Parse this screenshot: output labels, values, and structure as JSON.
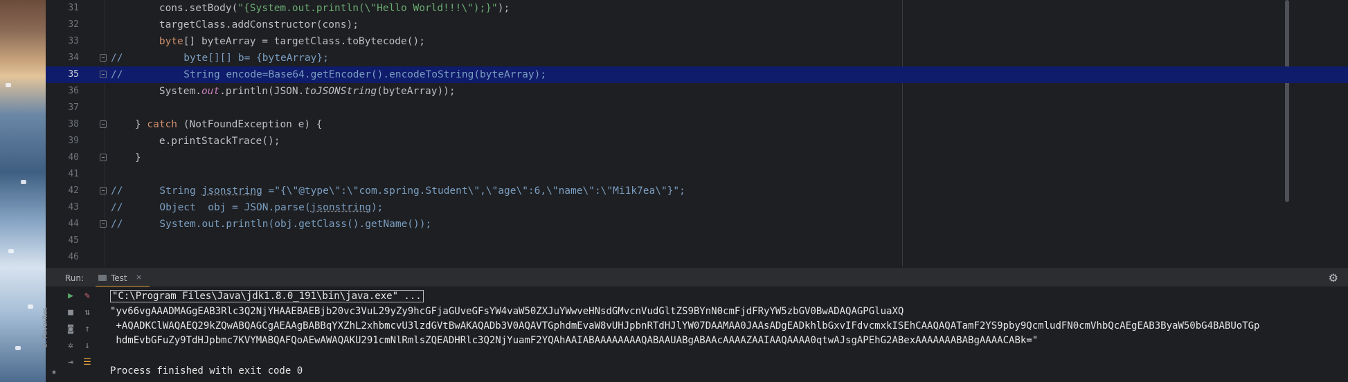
{
  "editor": {
    "lines": [
      {
        "num": "31",
        "segments": [
          {
            "t": "        cons.setBody(",
            "c": ""
          },
          {
            "t": "\"{System.out.println(\\\"Hello World!!!\\\");}\"",
            "c": "str"
          },
          {
            "t": ");",
            "c": ""
          }
        ]
      },
      {
        "num": "32",
        "segments": [
          {
            "t": "        targetClass.addConstructor(cons);",
            "c": ""
          }
        ]
      },
      {
        "num": "33",
        "segments": [
          {
            "t": "        ",
            "c": ""
          },
          {
            "t": "byte",
            "c": "kw"
          },
          {
            "t": "[] byteArray = targetClass.toBytecode();",
            "c": ""
          }
        ]
      },
      {
        "num": "34",
        "prefix": "//",
        "segments": [
          {
            "t": "          byte[][] b= {byteArray};",
            "c": "cm"
          }
        ]
      },
      {
        "num": "35",
        "prefix": "//",
        "current": true,
        "segments": [
          {
            "t": "          String encode=Base64.getEncoder().encodeToString(byteArray);",
            "c": "cm"
          }
        ]
      },
      {
        "num": "36",
        "segments": [
          {
            "t": "        System.",
            "c": ""
          },
          {
            "t": "out",
            "c": "fld"
          },
          {
            "t": ".println(JSON.",
            "c": ""
          },
          {
            "t": "toJSONString",
            "c": "it"
          },
          {
            "t": "(byteArray));",
            "c": ""
          }
        ]
      },
      {
        "num": "37",
        "segments": []
      },
      {
        "num": "38",
        "segments": [
          {
            "t": "    } ",
            "c": ""
          },
          {
            "t": "catch",
            "c": "kw"
          },
          {
            "t": " (NotFoundException e) {",
            "c": ""
          }
        ]
      },
      {
        "num": "39",
        "segments": [
          {
            "t": "        e.printStackTrace();",
            "c": ""
          }
        ]
      },
      {
        "num": "40",
        "segments": [
          {
            "t": "    }",
            "c": ""
          }
        ]
      },
      {
        "num": "41",
        "segments": []
      },
      {
        "num": "42",
        "prefix": "//",
        "segments": [
          {
            "t": "      String ",
            "c": "cm"
          },
          {
            "t": "jsonstring",
            "c": "cm und"
          },
          {
            "t": " =\"{\\\"@type\\\":\\\"com.spring.Student\\\",\\\"age\\\":6,\\\"name\\\":\\\"Mi1k7ea\\\"}\";",
            "c": "cm"
          }
        ]
      },
      {
        "num": "43",
        "prefix": "//",
        "segments": [
          {
            "t": "      Object  obj = JSON.parse(",
            "c": "cm"
          },
          {
            "t": "jsonstring",
            "c": "cm und"
          },
          {
            "t": ");",
            "c": "cm"
          }
        ]
      },
      {
        "num": "44",
        "prefix": "//",
        "segments": [
          {
            "t": "      System.out.println(obj.getClass().getName());",
            "c": "cm"
          }
        ]
      },
      {
        "num": "45",
        "segments": []
      },
      {
        "num": "46",
        "segments": []
      }
    ]
  },
  "run_panel": {
    "label": "Run:",
    "tab_label": "Test",
    "tab_close": "×",
    "side_label": "2: Favorites"
  },
  "console": {
    "command": "\"C:\\Program Files\\Java\\jdk1.8.0_191\\bin\\java.exe\" ...",
    "output_lines": [
      "\"yv66vgAAADMAGgEAB3Rlc3Q2NjYHAAEBAEBjb20vc3VuL29yZy9hcGFjaGUveGFsYW4vaW50ZXJuYWwveHNsdGMvcnVudGltZS9BYnN0cmFjdFRyYW5zbGV0BwADAQAGPGluaXQ",
      " +AQADKClWAQAEQ29kZQwABQAGCgAEAAgBABBqYXZhL2xhbmcvU3lzdGVtBwAKAQADb3V0AQAVTGphdmEvaW8vUHJpbnRTdHJlYW07DAAMAA0JAAsADgEADkhlbGxvIFdvcmxkISEhCAAQAQATamF2YS9pby9QcmludFN0cmVhbQcAEgEAB3ByaW50bG4BABUoTGp",
      " hdmEvbGFuZy9TdHJpbmc7KVYMABQAFQoAEwAWAQAKU291cmNlRmlsZQEADHRlc3Q2NjYuamF2YQAhAAIABAAAAAAAAQABAAUABgABAAcAAAAZAAIAAQAAAA0qtwAJsgAPEhG2ABexAAAAAAABABgAAAACABk=\""
    ],
    "exit_message": "Process finished with exit code 0"
  }
}
